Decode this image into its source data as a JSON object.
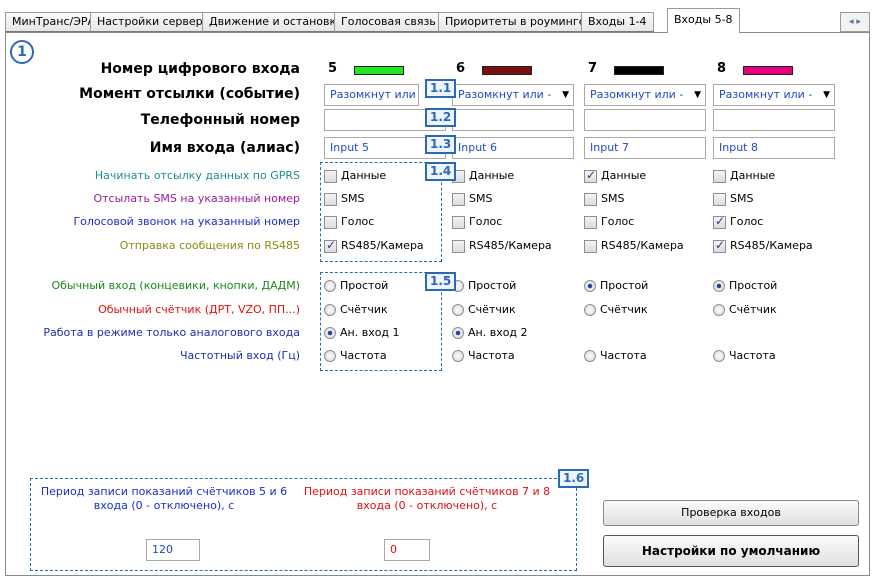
{
  "tabs": [
    {
      "label": "МинТранс/ЭРА"
    },
    {
      "label": "Настройки сервера"
    },
    {
      "label": "Движение и остановки"
    },
    {
      "label": "Голосовая связь"
    },
    {
      "label": "Приоритеты в роуминге"
    },
    {
      "label": "Входы 1-4"
    },
    {
      "label": "Входы 5-8",
      "active": true
    }
  ],
  "tab_scroll": "◂ ▸",
  "markers": {
    "main": "1",
    "c11": "1.1",
    "c12": "1.2",
    "c13": "1.3",
    "c14": "1.4",
    "c15": "1.5",
    "c16": "1.6"
  },
  "row_labels": {
    "input_number": "Номер цифрового входа",
    "event": "Момент отсылки (событие)",
    "phone": "Телефонный номер",
    "alias": "Имя входа (алиас)",
    "gprs": "Начинать отсылку данных по GPRS",
    "sms": "Отсылать SMS на указанный номер",
    "voice": "Голосовой звонок на указанный номер",
    "rs485": "Отправка сообщения по RS485",
    "simple": "Обычный вход (концевики, кнопки, ДАДМ)",
    "counter": "Обычный счётчик (ДРТ, VZO, ПП...)",
    "analog": "Работа в режиме только аналогового входа",
    "freq": "Частотный вход (Гц)"
  },
  "colors": {
    "gprs": "#1a8f8f",
    "sms": "#9a1a9a",
    "voice": "#1a2fc8",
    "rs485": "#8a8a10",
    "simple": "#1a8a1a",
    "counter": "#e01010",
    "analog": "#1a2fb0",
    "freq": "#1a2fb0",
    "accent": "#2b6ab3"
  },
  "columns": [
    {
      "number": "5",
      "swatch": "#22e622",
      "event": "Разомкнут или ",
      "phone": "",
      "alias": "Input 5",
      "check_labels": {
        "gprs": "Данные",
        "sms": "SMS",
        "voice": "Голос",
        "rs485": "RS485/Камера"
      },
      "checks": {
        "gprs": false,
        "sms": false,
        "voice": false,
        "rs485": true
      },
      "radio_labels": {
        "simple": "Простой",
        "counter": "Счётчик",
        "analog": "Ан. вход 1",
        "freq": "Частота"
      },
      "mode": "analog"
    },
    {
      "number": "6",
      "swatch": "#7a0f0f",
      "event": "Разомкнут или -",
      "phone": "",
      "alias": "Input 6",
      "check_labels": {
        "gprs": "Данные",
        "sms": "SMS",
        "voice": "Голос",
        "rs485": "RS485/Камера"
      },
      "checks": {
        "gprs": false,
        "sms": false,
        "voice": false,
        "rs485": false
      },
      "radio_labels": {
        "simple": "Простой",
        "counter": "Счётчик",
        "analog": "Ан. вход 2",
        "freq": "Частота"
      },
      "mode": "analog"
    },
    {
      "number": "7",
      "swatch": "#000000",
      "event": "Разомкнут или -",
      "phone": "",
      "alias": "Input 7",
      "check_labels": {
        "gprs": "Данные",
        "sms": "SMS",
        "voice": "Голос",
        "rs485": "RS485/Камера"
      },
      "checks": {
        "gprs": true,
        "sms": false,
        "voice": false,
        "rs485": false
      },
      "radio_labels": {
        "simple": "Простой",
        "counter": "Счётчик",
        "analog": "",
        "freq": "Частота"
      },
      "mode": "simple"
    },
    {
      "number": "8",
      "swatch": "#e6007e",
      "event": "Разомкнут или -",
      "phone": "",
      "alias": "Input 8",
      "check_labels": {
        "gprs": "Данные",
        "sms": "SMS",
        "voice": "Голос",
        "rs485": "RS485/Камера"
      },
      "checks": {
        "gprs": false,
        "sms": false,
        "voice": true,
        "rs485": true
      },
      "radio_labels": {
        "simple": "Простой",
        "counter": "Счётчик",
        "analog": "",
        "freq": "Частота"
      },
      "mode": "simple"
    }
  ],
  "period": {
    "label_56": "Период записи показаний счётчиков 5 и 6 входа (0 - отключено), с",
    "value_56": "120",
    "label_78": "Период записи показаний счётчиков 7 и 8 входа (0 - отключено), с",
    "value_78": "0",
    "color_56": "#1a2fc8",
    "color_78": "#e01010"
  },
  "buttons": {
    "check_inputs": "Проверка входов",
    "defaults": "Настройки по умолчанию"
  }
}
